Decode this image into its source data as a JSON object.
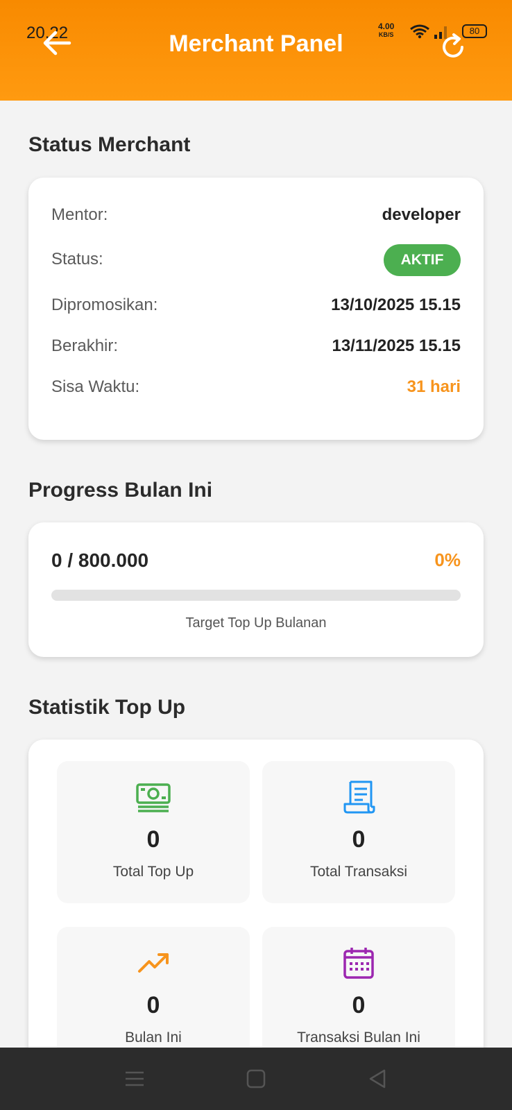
{
  "status_bar": {
    "time": "20.22",
    "speed_value": "4.00",
    "speed_unit": "KB/S",
    "battery": "80"
  },
  "header": {
    "title": "Merchant Panel",
    "back_icon": "arrow-left-icon",
    "refresh_icon": "refresh-icon"
  },
  "status_section": {
    "title": "Status Merchant",
    "rows": [
      {
        "label": "Mentor:",
        "value": "developer"
      },
      {
        "label": "Status:",
        "value": "AKTIF"
      },
      {
        "label": "Dipromosikan:",
        "value": "13/10/2025 15.15"
      },
      {
        "label": "Berakhir:",
        "value": "13/11/2025 15.15"
      },
      {
        "label": "Sisa Waktu:",
        "value": "31 hari"
      }
    ]
  },
  "progress_section": {
    "title": "Progress Bulan Ini",
    "amount": "0 / 800.000",
    "percent": "0%",
    "fill_fraction": 0,
    "caption": "Target Top Up Bulanan"
  },
  "stats_section": {
    "title": "Statistik Top Up",
    "items": [
      {
        "icon": "money-icon",
        "value": "0",
        "label": "Total Top Up",
        "color": "#4caf50"
      },
      {
        "icon": "receipt-icon",
        "value": "0",
        "label": "Total Transaksi",
        "color": "#2196f3"
      },
      {
        "icon": "trending-up-icon",
        "value": "0",
        "label": "Bulan Ini",
        "color": "#f7941d"
      },
      {
        "icon": "calendar-icon",
        "value": "0",
        "label": "Transaksi Bulan Ini",
        "color": "#9c27b0"
      }
    ]
  },
  "colors": {
    "header": "#ff9a10",
    "accent": "#f7941d",
    "active_badge": "#4caf50"
  },
  "nav_bar": {
    "icons": [
      "menu-icon",
      "home-square-icon",
      "back-triangle-icon"
    ]
  }
}
